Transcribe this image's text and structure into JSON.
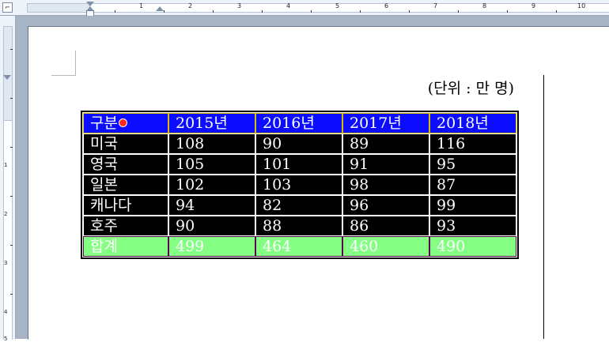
{
  "ruler": {
    "corner_icon": "tab-type-icon",
    "corner_glyph": "⌐",
    "numbers": [
      "1",
      "2",
      "3",
      "4",
      "5",
      "6",
      "7",
      "8",
      "9",
      "10"
    ],
    "vertical_numbers": [
      "1",
      "2",
      "3",
      "4",
      "5"
    ]
  },
  "unit_label": "(단위 : 만 명)",
  "table": {
    "header": [
      "구분",
      "2015년",
      "2016년",
      "2017년",
      "2018년"
    ],
    "rows": [
      [
        "미국",
        "108",
        "90",
        "89",
        "116"
      ],
      [
        "영국",
        "105",
        "101",
        "91",
        "95"
      ],
      [
        "일본",
        "102",
        "103",
        "98",
        "87"
      ],
      [
        "캐나다",
        "94",
        "82",
        "96",
        "99"
      ],
      [
        "호주",
        "90",
        "88",
        "86",
        "93"
      ]
    ],
    "total": [
      "합계",
      "499",
      "464",
      "460",
      "490"
    ]
  },
  "colors": {
    "header_bg": "#0c0cff",
    "row_bg": "#000000",
    "total_bg": "#84ff84",
    "text": "#ffffff",
    "cursor_dot": "#ff2a1a"
  }
}
